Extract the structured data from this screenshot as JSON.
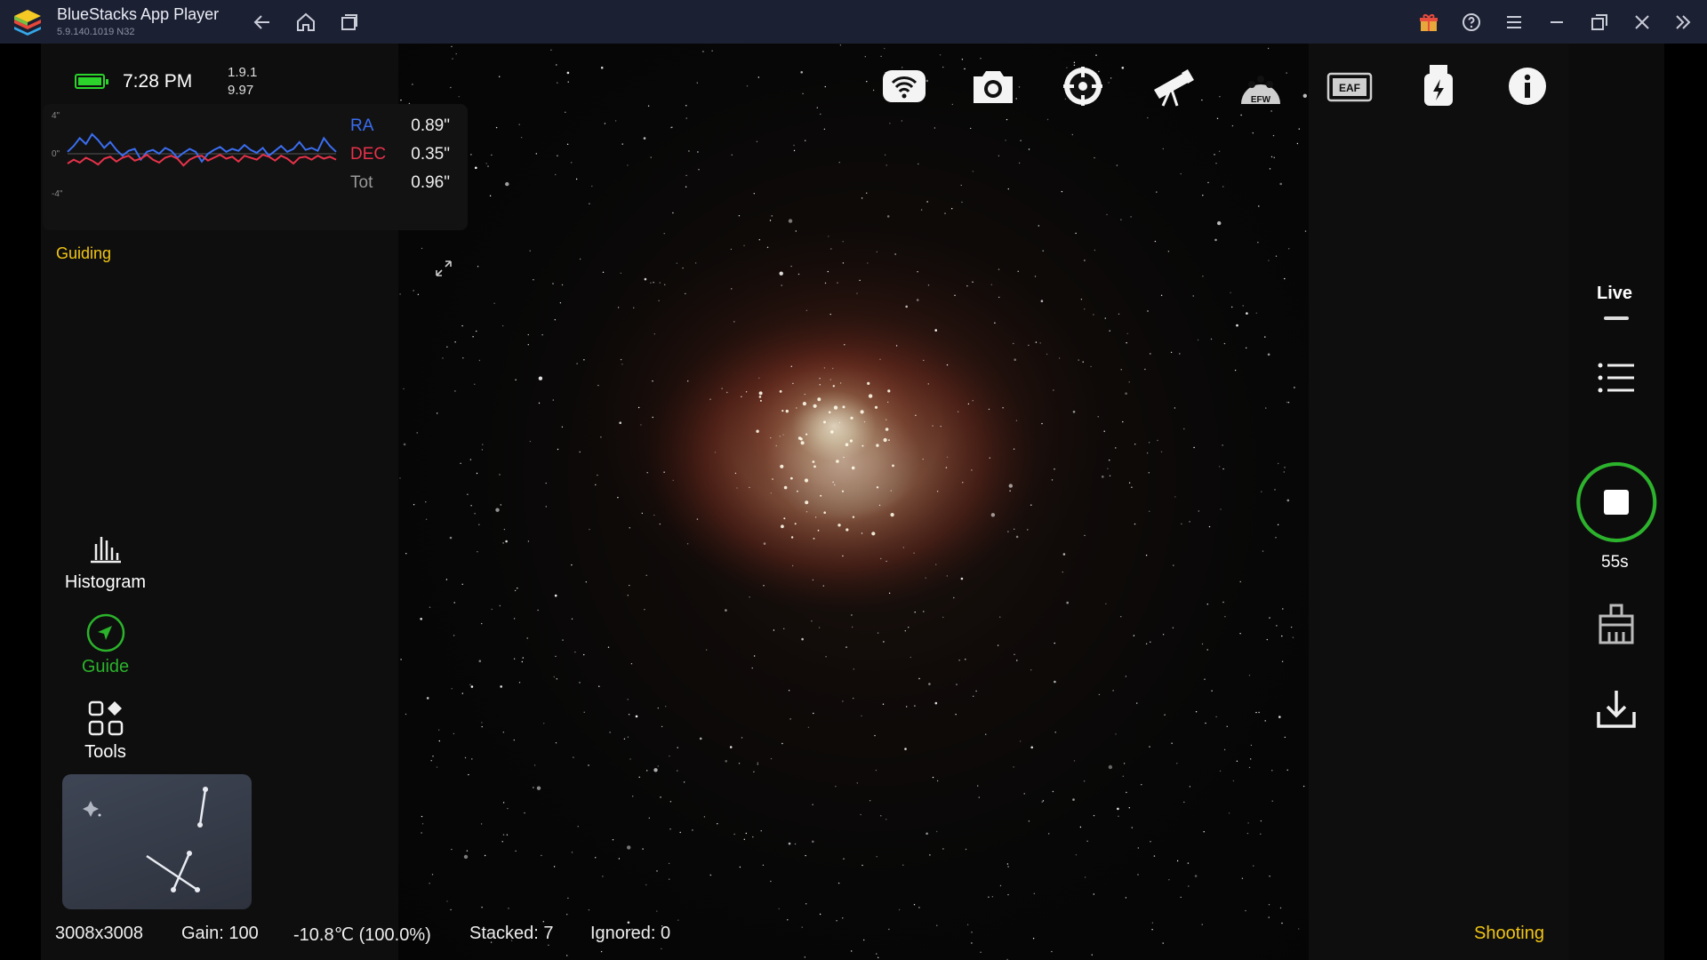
{
  "window": {
    "title": "BlueStacks App Player",
    "version": "5.9.140.1019  N32",
    "icons": [
      "back-icon",
      "home-icon",
      "recent-apps-icon",
      "gift-icon",
      "help-icon",
      "menu-icon",
      "minimize-icon",
      "restore-icon",
      "close-icon",
      "collapse-sidebar-icon"
    ]
  },
  "status": {
    "time": "7:28 PM",
    "battery_level": 1.0,
    "version_line1": "1.9.1",
    "version_line2": "9.97"
  },
  "guide": {
    "axis_top": "4\"",
    "axis_mid": "0\"",
    "axis_bottom": "-4\"",
    "ra_label": "RA",
    "ra_value": "0.89\"",
    "dec_label": "DEC",
    "dec_value": "0.35\"",
    "tot_label": "Tot",
    "tot_value": "0.96\"",
    "state": "Guiding",
    "colors": {
      "ra": "#3a6df0",
      "dec": "#e8324a",
      "guiding": "#f2c513"
    },
    "ra_series": [
      0.2,
      0.8,
      1.6,
      1.0,
      2.0,
      1.4,
      0.6,
      1.2,
      0.4,
      -0.2,
      0.3,
      0.5,
      -0.6,
      0.2,
      0.4,
      0.0,
      0.6,
      0.3,
      -0.4,
      0.1,
      0.5,
      0.2,
      -0.8,
      0.0,
      0.4,
      0.7,
      0.2,
      0.5,
      0.3,
      0.9,
      0.4,
      0.1,
      0.6,
      -0.2,
      0.3,
      0.8,
      0.2,
      0.5,
      1.2,
      0.4,
      0.6,
      0.3,
      1.6,
      0.8,
      0.2
    ],
    "dec_series": [
      -1.0,
      -0.6,
      -0.9,
      -0.4,
      -0.7,
      -1.1,
      -0.5,
      -0.3,
      -0.8,
      -0.4,
      -0.2,
      -0.7,
      -0.5,
      -0.1,
      -0.6,
      -0.9,
      -0.4,
      -0.2,
      -0.5,
      -1.2,
      -0.6,
      -0.3,
      -0.2,
      -0.7,
      -0.4,
      -0.1,
      -0.5,
      -0.3,
      -0.8,
      -0.2,
      -0.4,
      -0.6,
      -0.1,
      -0.3,
      -0.7,
      -0.2,
      -0.5,
      -1.0,
      -0.4,
      -0.3,
      -0.6,
      -0.2,
      -0.5,
      -0.3,
      -0.6
    ]
  },
  "tools": {
    "histogram": "Histogram",
    "guide": "Guide",
    "tools": "Tools"
  },
  "bottom": {
    "resolution": "3008x3008",
    "gain": "Gain: 100",
    "temperature": "-10.8℃  (100.0%)",
    "stacked": "Stacked: 7",
    "ignored": "Ignored: 0",
    "state": "Shooting"
  },
  "toolbar": {
    "icons": [
      "wifi-icon",
      "camera-icon",
      "guide-scope-icon",
      "telescope-icon",
      "efw-icon",
      "eaf-icon",
      "usb-power-icon",
      "info-icon"
    ],
    "efw_text": "EFW",
    "eaf_text": "EAF"
  },
  "right": {
    "live_label": "Live",
    "timer": "55s",
    "accent": "#2bb32b"
  }
}
